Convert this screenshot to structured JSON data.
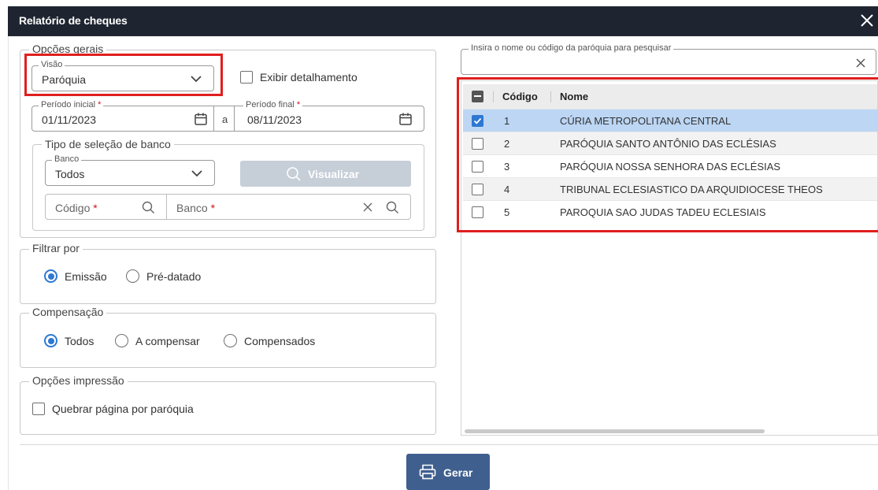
{
  "window": {
    "title": "Relatório de cheques",
    "close_icon": "close-icon"
  },
  "opcoes_gerais": {
    "legend": "Opções gerais",
    "visao": {
      "label": "Visão",
      "value": "Paróquia"
    },
    "exibir_detalhamento": {
      "label": "Exibir detalhamento",
      "checked": false
    },
    "periodo_inicial": {
      "label": "Período inicial",
      "required": "*",
      "value": "01/11/2023"
    },
    "separator": "a",
    "periodo_final": {
      "label": "Período final",
      "required": "*",
      "value": "08/11/2023"
    },
    "tipo_selecao_banco": {
      "legend": "Tipo de seleção de banco",
      "banco": {
        "label": "Banco",
        "value": "Todos"
      },
      "visualizar_label": "Visualizar",
      "codigo": {
        "placeholder": "Código",
        "required": "*"
      },
      "banco_search": {
        "placeholder": "Banco",
        "required": "*"
      }
    }
  },
  "filtrar_por": {
    "legend": "Filtrar por",
    "options": [
      {
        "label": "Emissão",
        "selected": true
      },
      {
        "label": "Pré-datado",
        "selected": false
      }
    ]
  },
  "compensacao": {
    "legend": "Compensação",
    "options": [
      {
        "label": "Todos",
        "selected": true
      },
      {
        "label": "A compensar",
        "selected": false
      },
      {
        "label": "Compensados",
        "selected": false
      }
    ]
  },
  "opcoes_impressao": {
    "legend": "Opções impressão",
    "quebrar_pagina": {
      "label": "Quebrar página por paróquia",
      "checked": false
    }
  },
  "search": {
    "label": "Insira o nome ou código da paróquia para pesquisar",
    "value": ""
  },
  "grid": {
    "columns": [
      "Código",
      "Nome"
    ],
    "rows": [
      {
        "code": "1",
        "name": "CÚRIA METROPOLITANA CENTRAL",
        "checked": true
      },
      {
        "code": "2",
        "name": "PARÓQUIA SANTO ANTÔNIO DAS ECLÉSIAS",
        "checked": false
      },
      {
        "code": "3",
        "name": "PARÓQUIA NOSSA SENHORA DAS ECLÉSIAS",
        "checked": false
      },
      {
        "code": "4",
        "name": "TRIBUNAL ECLESIASTICO DA ARQUIDIOCESE THEOS",
        "checked": false
      },
      {
        "code": "5",
        "name": "PAROQUIA SAO JUDAS TADEU ECLESIAIS",
        "checked": false
      }
    ]
  },
  "footer": {
    "gerar_label": "Gerar"
  },
  "colors": {
    "accent": "#2e78d2",
    "titlebar": "#1f2530",
    "highlight": "#e01e1e",
    "primary_button": "#3f5f8f",
    "disabled_button": "#c6ced8"
  }
}
